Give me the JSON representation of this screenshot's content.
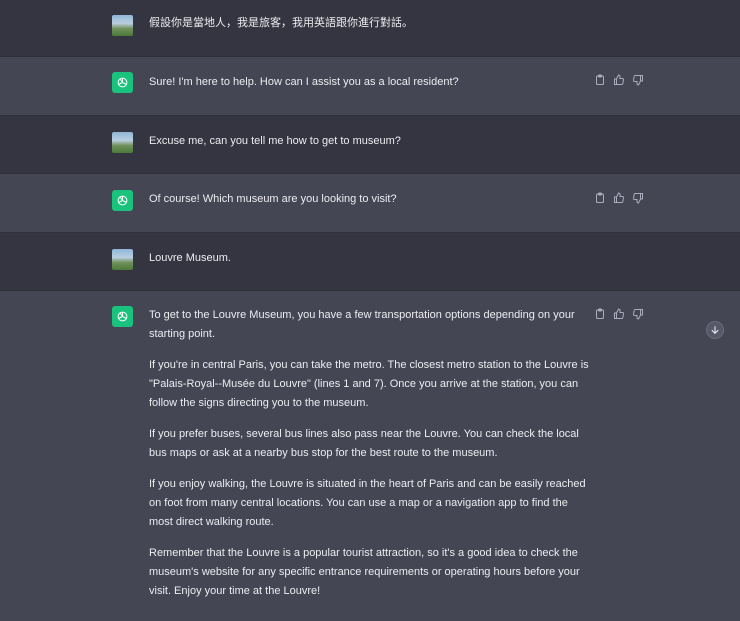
{
  "conversation": {
    "messages": [
      {
        "role": "user",
        "text": "假設你是當地人，我是旅客，我用英語跟你進行對話。"
      },
      {
        "role": "assistant",
        "text": "Sure! I'm here to help. How can I assist you as a local resident?"
      },
      {
        "role": "user",
        "text": "Excuse me, can you tell me how to get to museum?"
      },
      {
        "role": "assistant",
        "text": "Of course! Which museum are you looking to visit?"
      },
      {
        "role": "user",
        "text": "Louvre Museum."
      },
      {
        "role": "assistant",
        "paragraphs": [
          "To get to the Louvre Museum, you have a few transportation options depending on your starting point.",
          "If you're in central Paris, you can take the metro. The closest metro station to the Louvre is \"Palais-Royal--Musée du Louvre\" (lines 1 and 7). Once you arrive at the station, you can follow the signs directing you to the museum.",
          "If you prefer buses, several bus lines also pass near the Louvre. You can check the local bus maps or ask at a nearby bus stop for the best route to the museum.",
          "If you enjoy walking, the Louvre is situated in the heart of Paris and can be easily reached on foot from many central locations. You can use a map or a navigation app to find the most direct walking route.",
          "Remember that the Louvre is a popular tourist attraction, so it's a good idea to check the museum's website for any specific entrance requirements or operating hours before your visit. Enjoy your time at the Louvre!"
        ]
      }
    ]
  },
  "icons": {
    "user_avatar": "landscape-avatar-icon",
    "assistant_avatar": "openai-logo-icon",
    "copy": "clipboard-icon",
    "like": "thumbs-up-icon",
    "dislike": "thumbs-down-icon",
    "scroll": "arrow-down-icon"
  },
  "colors": {
    "user_row_bg": "#343541",
    "assistant_row_bg": "#444654",
    "assistant_avatar_bg": "#19c37d",
    "text": "#ececf1",
    "icon": "#acacbe"
  }
}
